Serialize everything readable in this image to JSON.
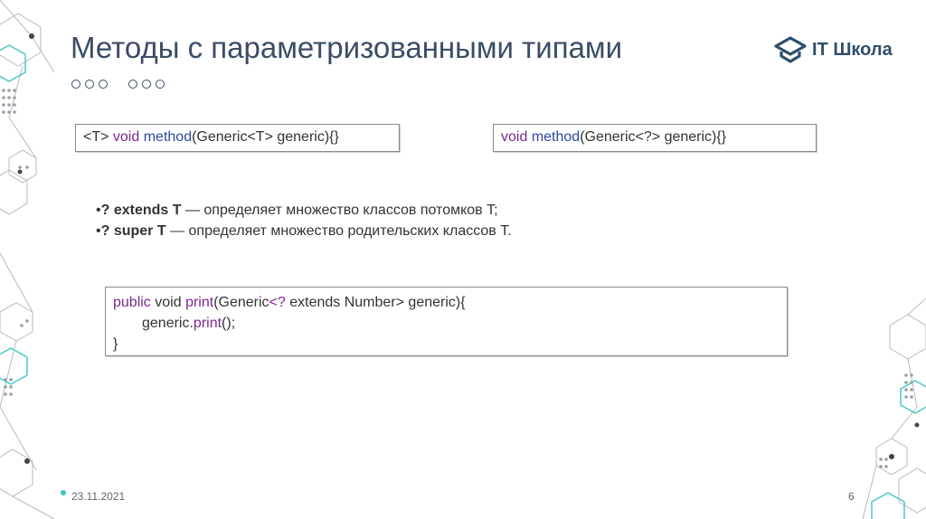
{
  "slide": {
    "title": "Методы с параметризованными типами",
    "date": "23.11.2021",
    "page_number": "6"
  },
  "logo": {
    "text": "IT Школа"
  },
  "code_box_1": {
    "p1": "<T> ",
    "kw1": "void",
    "p2": " ",
    "fn1": "method",
    "p3": "(Generic<T> generic){}"
  },
  "code_box_2": {
    "kw1": "void",
    "p1": " ",
    "fn1": "method",
    "p2": "(Generic<?> generic){}"
  },
  "bullets": [
    {
      "marker": "•",
      "bold": "? extends T",
      "text": " — определяет множество классов потомков T;"
    },
    {
      "marker": "•",
      "bold": "? super T",
      "text": " — определяет множество родительских классов T."
    }
  ],
  "code_box_3": {
    "line1": {
      "kw1": "public",
      "p1": " void ",
      "fn1": "print",
      "p2": "(Generic",
      "kw2": "<?",
      "p3": " extends Number> generic){"
    },
    "line2": {
      "p1": "generic.",
      "fn1": "print",
      "p2": "();"
    },
    "line3": {
      "p1": "}"
    }
  },
  "colors": {
    "title": "#3b4c66",
    "keyword": "#7a2a8c",
    "method": "#2b4aa0",
    "decor_teal": "#3ec6c6",
    "decor_gray": "#9aa0a6"
  }
}
